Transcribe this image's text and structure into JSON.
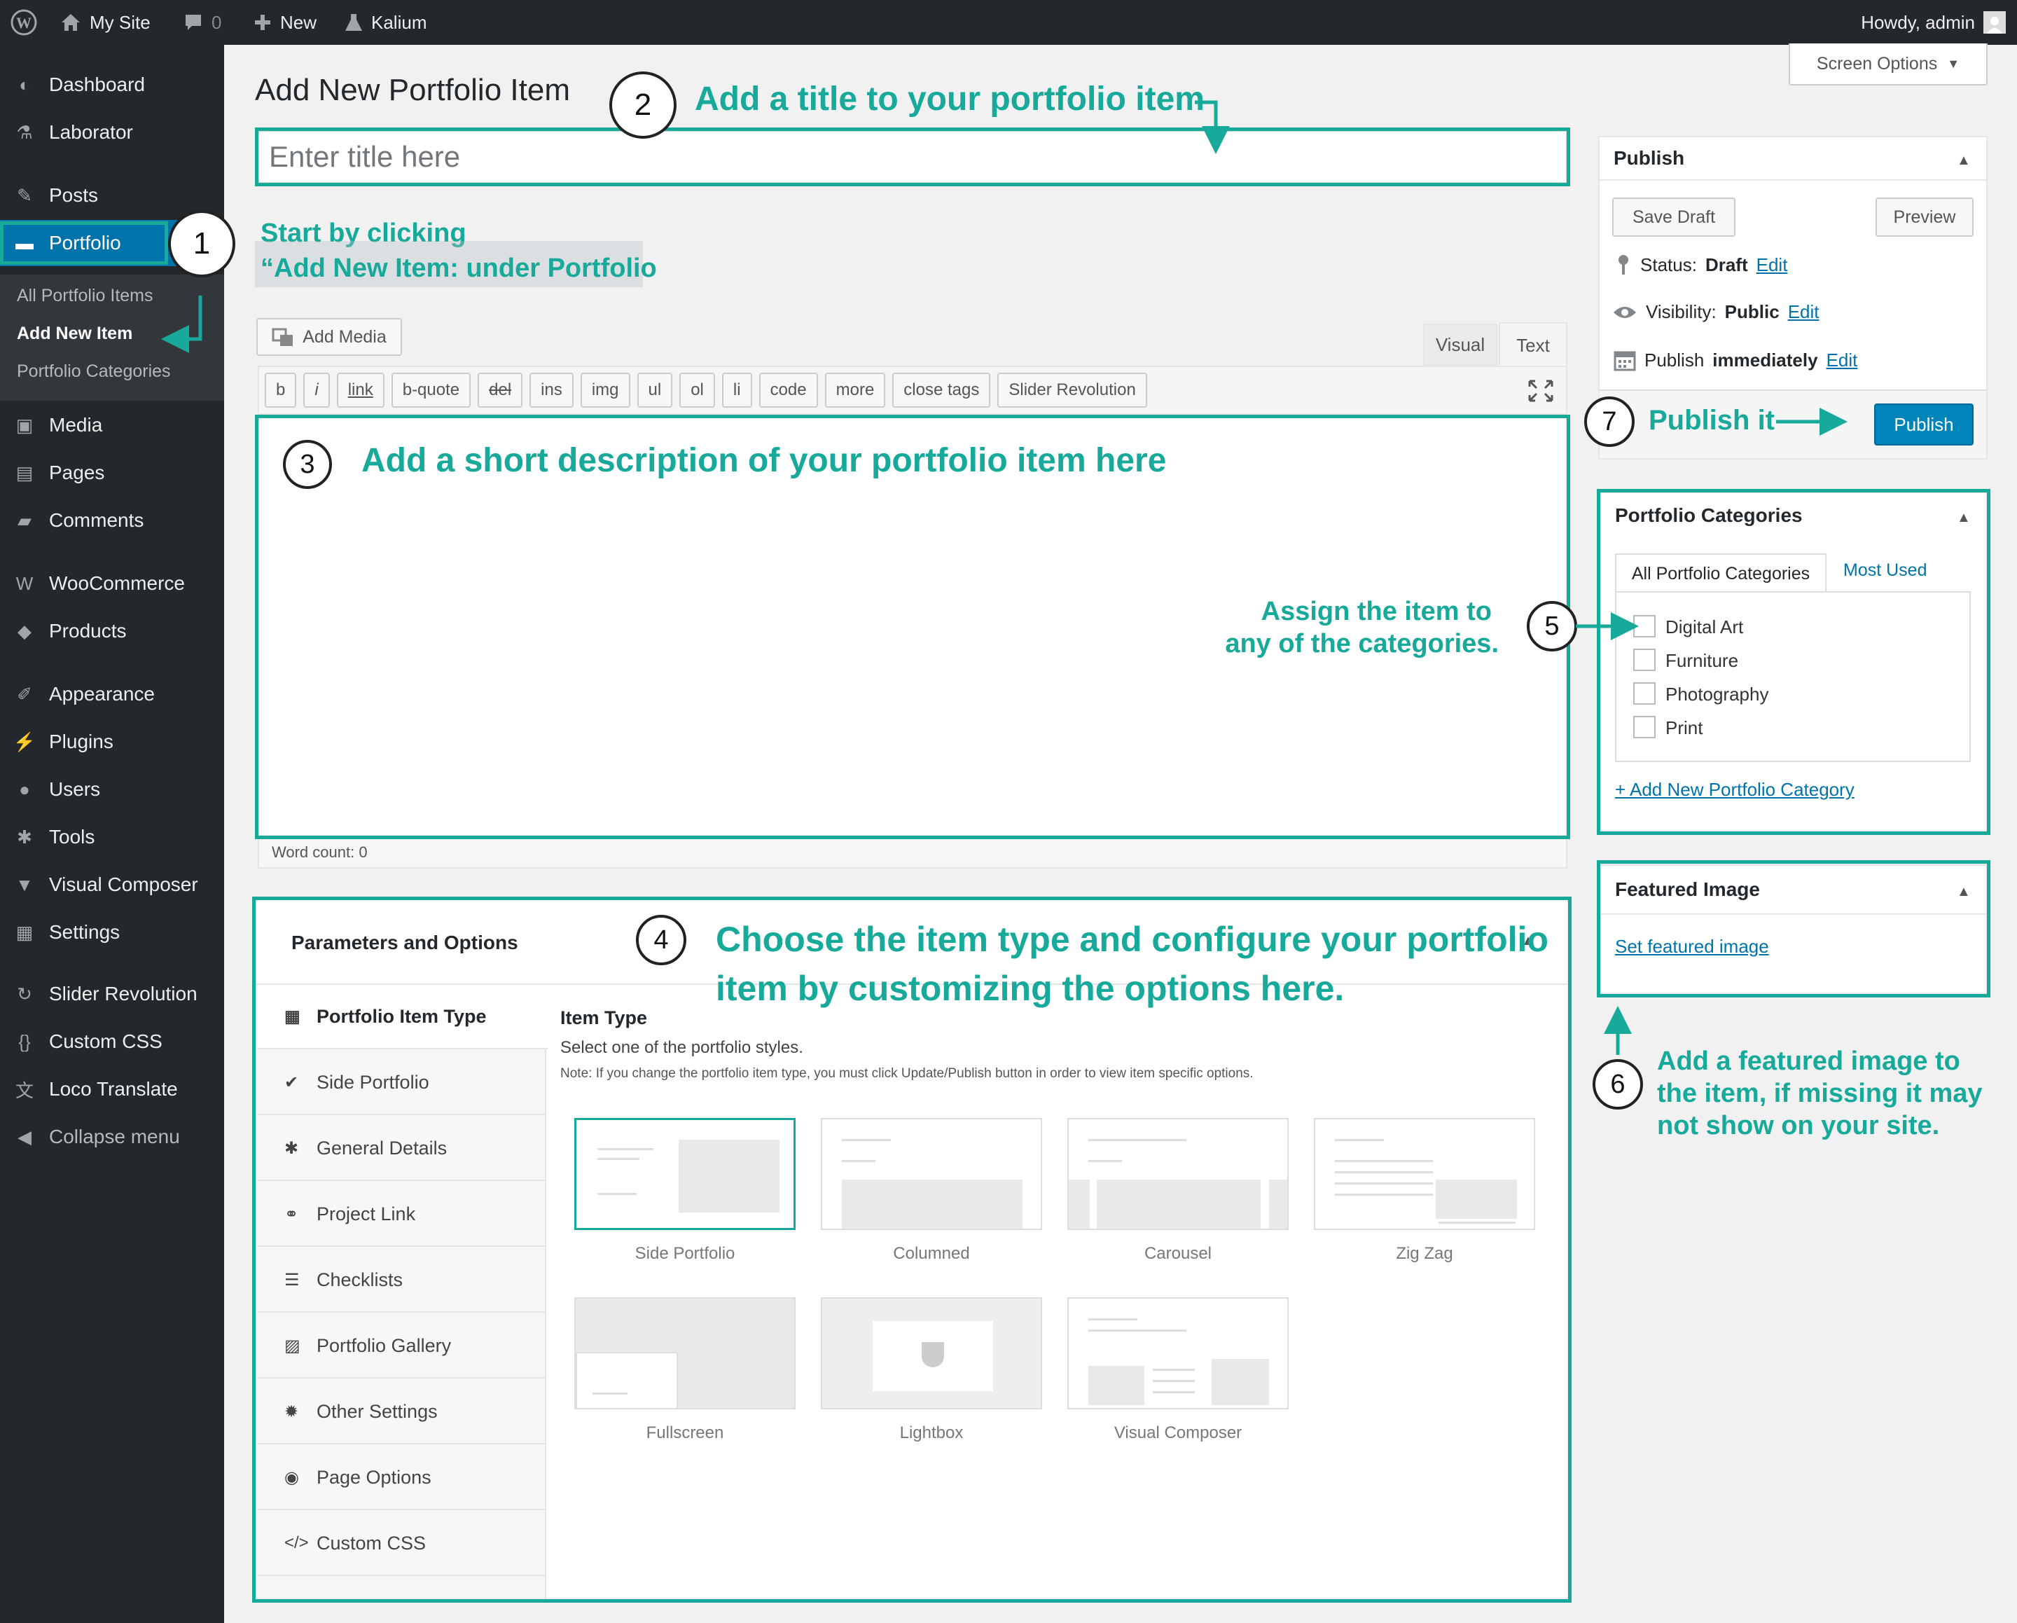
{
  "adminbar": {
    "site": "My Site",
    "comments": "0",
    "new": "New",
    "theme": "Kalium",
    "howdy": "Howdy, admin"
  },
  "sidebar": {
    "items": [
      {
        "label": "Dashboard",
        "icon": "dashboard-icon"
      },
      {
        "label": "Laborator",
        "icon": "flask-icon"
      },
      {
        "label": "Posts",
        "icon": "pin-icon"
      },
      {
        "label": "Portfolio",
        "icon": "folder-icon"
      },
      {
        "label": "Media",
        "icon": "media-icon"
      },
      {
        "label": "Pages",
        "icon": "pages-icon"
      },
      {
        "label": "Comments",
        "icon": "comment-icon"
      },
      {
        "label": "WooCommerce",
        "icon": "woo-icon"
      },
      {
        "label": "Products",
        "icon": "box-icon"
      },
      {
        "label": "Appearance",
        "icon": "brush-icon"
      },
      {
        "label": "Plugins",
        "icon": "plug-icon"
      },
      {
        "label": "Users",
        "icon": "user-icon"
      },
      {
        "label": "Tools",
        "icon": "wrench-icon"
      },
      {
        "label": "Visual Composer",
        "icon": "vc-icon"
      },
      {
        "label": "Settings",
        "icon": "settings-icon"
      },
      {
        "label": "Slider Revolution",
        "icon": "refresh-icon"
      },
      {
        "label": "Custom CSS",
        "icon": "braces-icon"
      },
      {
        "label": "Loco Translate",
        "icon": "translate-icon"
      },
      {
        "label": "Collapse menu",
        "icon": "collapse-icon"
      }
    ],
    "submenu": [
      "All Portfolio Items",
      "Add New Item",
      "Portfolio Categories"
    ]
  },
  "screen_options": "Screen Options",
  "page_title": "Add New Portfolio Item",
  "title_placeholder": "Enter title here",
  "editor": {
    "add_media": "Add Media",
    "tab_visual": "Visual",
    "tab_text": "Text",
    "quicktags": [
      "b",
      "i",
      "link",
      "b-quote",
      "del",
      "ins",
      "img",
      "ul",
      "ol",
      "li",
      "code",
      "more",
      "close tags",
      "Slider Revolution"
    ],
    "word_count": "Word count: 0"
  },
  "params": {
    "title": "Parameters and Options",
    "tabs": [
      "Portfolio Item Type",
      "Side Portfolio",
      "General Details",
      "Project Link",
      "Checklists",
      "Portfolio Gallery",
      "Other Settings",
      "Page Options",
      "Custom CSS"
    ],
    "item_type_title": "Item Type",
    "item_type_desc": "Select one of the portfolio styles.",
    "item_type_note": "Note: If you change the portfolio item type, you must click Update/Publish button in order to view item specific options.",
    "types": [
      "Side Portfolio",
      "Columned",
      "Carousel",
      "Zig Zag",
      "Fullscreen",
      "Lightbox",
      "Visual Composer"
    ]
  },
  "publish": {
    "title": "Publish",
    "save_draft": "Save Draft",
    "preview": "Preview",
    "status_label": "Status:",
    "status_value": "Draft",
    "visibility_label": "Visibility:",
    "visibility_value": "Public",
    "publish_label": "Publish",
    "publish_value": "immediately",
    "edit": "Edit",
    "publish_button": "Publish"
  },
  "categories": {
    "title": "Portfolio Categories",
    "tab_all": "All Portfolio Categories",
    "tab_most": "Most Used",
    "items": [
      "Digital Art",
      "Furniture",
      "Photography",
      "Print"
    ],
    "add_new": "+ Add New Portfolio Category"
  },
  "featured": {
    "title": "Featured Image",
    "set": "Set featured image"
  },
  "annotations": {
    "n1": "1",
    "n2": "2",
    "n3": "3",
    "n4": "4",
    "n5": "5",
    "n6": "6",
    "n7": "7",
    "a1_line1": "Start by clicking",
    "a1_line2": "“Add New Item:  under Portfolio",
    "a2": "Add a title to your portfolio item",
    "a3": "Add a short description of your portfolio item here",
    "a4_line1": "Choose the item type and configure your portfolio",
    "a4_line2": "item by customizing the options here.",
    "a5_line1": "Assign the item to",
    "a5_line2": "any of the categories.",
    "a6_line1": "Add a featured image to",
    "a6_line2": "the item, if missing it may",
    "a6_line3": "not show on your site.",
    "a7": "Publish it"
  },
  "colors": {
    "accent": "#17a99a",
    "wp_blue": "#0073aa",
    "admin_dark": "#23282d"
  }
}
